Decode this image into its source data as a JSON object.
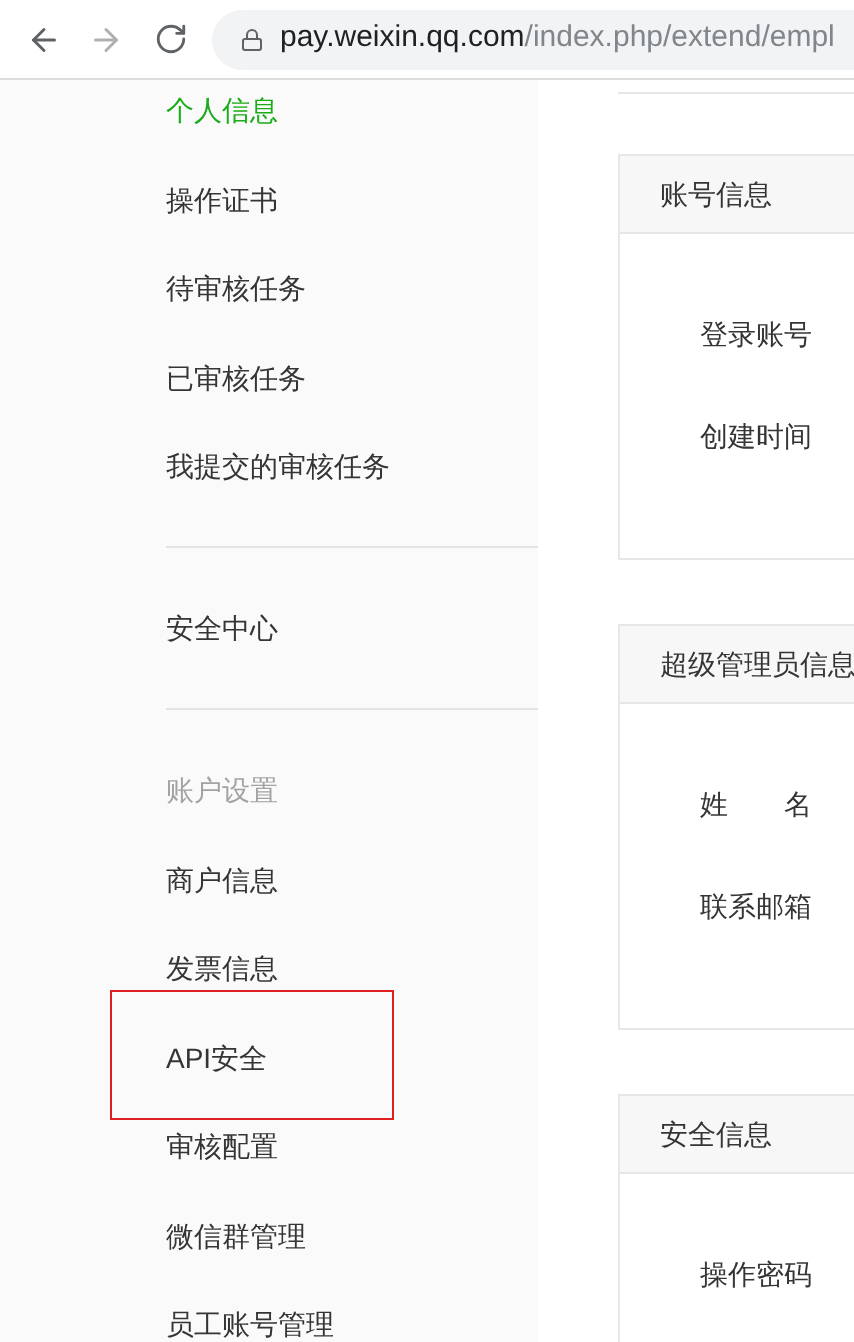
{
  "browser": {
    "back": {
      "disabled": false
    },
    "forward": {
      "disabled": true
    },
    "url_host": "pay.weixin.qq.com",
    "url_path": "/index.php/extend/empl"
  },
  "sidebar": {
    "groups": [
      {
        "items": [
          {
            "label": "个人信息",
            "selected": true,
            "highlighted": false
          },
          {
            "label": "操作证书",
            "selected": false,
            "highlighted": false
          },
          {
            "label": "待审核任务",
            "selected": false,
            "highlighted": false
          },
          {
            "label": "已审核任务",
            "selected": false,
            "highlighted": false
          },
          {
            "label": "我提交的审核任务",
            "selected": false,
            "highlighted": false
          }
        ]
      },
      {
        "items": [
          {
            "label": "安全中心",
            "selected": false,
            "highlighted": false
          }
        ]
      },
      {
        "heading": "账户设置",
        "items": [
          {
            "label": "商户信息",
            "selected": false,
            "highlighted": false
          },
          {
            "label": "发票信息",
            "selected": false,
            "highlighted": false
          },
          {
            "label": "API安全",
            "selected": false,
            "highlighted": true
          },
          {
            "label": "审核配置",
            "selected": false,
            "highlighted": false
          },
          {
            "label": "微信群管理",
            "selected": false,
            "highlighted": false
          },
          {
            "label": "员工账号管理",
            "selected": false,
            "highlighted": false
          }
        ]
      }
    ]
  },
  "cards": [
    {
      "title": "账号信息",
      "fields": [
        "登录账号",
        "创建时间"
      ]
    },
    {
      "title": "超级管理员信息",
      "fields": [
        "姓　　名",
        "联系邮箱"
      ]
    },
    {
      "title": "安全信息",
      "fields": [
        "操作密码"
      ]
    }
  ]
}
